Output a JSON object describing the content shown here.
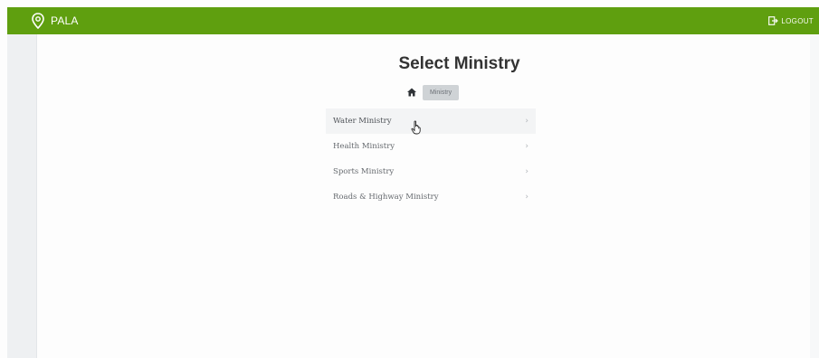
{
  "topbar": {
    "brand": "PALA",
    "logout_label": "LOGOUT",
    "color": "#5f9f0f"
  },
  "page": {
    "title": "Select Ministry"
  },
  "breadcrumb": {
    "home_icon": "home-icon",
    "current": "Ministry"
  },
  "ministries": [
    {
      "label": "Water Ministry",
      "chevron": "›"
    },
    {
      "label": "Health Ministry",
      "chevron": "›"
    },
    {
      "label": "Sports Ministry",
      "chevron": "›"
    },
    {
      "label": "Roads & Highway Ministry",
      "chevron": "›"
    }
  ]
}
